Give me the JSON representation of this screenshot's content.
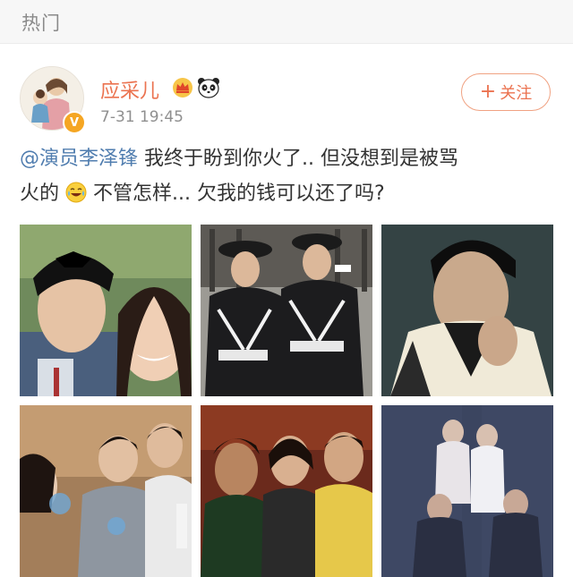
{
  "header": {
    "title": "热门"
  },
  "post": {
    "username": "应采儿",
    "time": "7-31 19:45",
    "follow_label": "关注",
    "follow_plus": "+",
    "mention": "@演员李泽锋",
    "text_part1": " 我终于盼到你火了.. 但没想到是被骂",
    "text_part2": "火的",
    "text_part3": " 不管怎样... 欠我的钱可以还了吗?",
    "verified_symbol": "V",
    "icons": {
      "vip": "crown-icon",
      "panda": "panda-icon",
      "emoji": "laugh-cry-emoji",
      "verified": "verified-badge"
    },
    "colors": {
      "username": "#eb7350",
      "mention": "#507daf",
      "follow_border": "#f0a282"
    },
    "photos_count_shown": 6
  }
}
